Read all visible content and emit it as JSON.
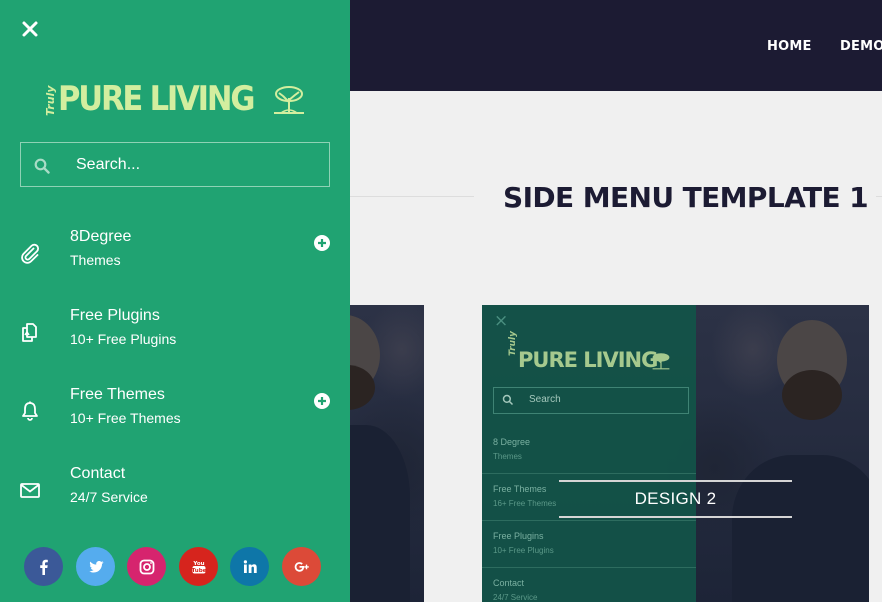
{
  "nav": {
    "home": "HOME",
    "demo": "DEMO"
  },
  "page": {
    "heading": "SIDE MENU TEMPLATE 1"
  },
  "thumbnail": {
    "label": "DESIGN 2",
    "mini_menu": {
      "close_icon": "×",
      "logo_small": "Truly",
      "logo": "PURE LIVING",
      "search_placeholder": "Search",
      "items": [
        {
          "title": "8 Degree",
          "sub": "Themes"
        },
        {
          "title": "Free Themes",
          "sub": "16+ Free Themes"
        },
        {
          "title": "Free Plugins",
          "sub": "10+ Free Plugins"
        },
        {
          "title": "Contact",
          "sub": "24/7 Service"
        }
      ]
    }
  },
  "sidemenu": {
    "logo_small": "Truly",
    "logo": "PURE LIVING",
    "search_placeholder": "Search...",
    "items": [
      {
        "title": "8Degree",
        "sub": "Themes",
        "icon": "paperclip-icon",
        "expandable": true
      },
      {
        "title": "Free Plugins",
        "sub": "10+ Free Plugins",
        "icon": "copy-icon",
        "expandable": false
      },
      {
        "title": "Free Themes",
        "sub": "10+ Free Themes",
        "icon": "bell-icon",
        "expandable": true
      },
      {
        "title": "Contact",
        "sub": "24/7 Service",
        "icon": "envelope-icon",
        "expandable": false
      }
    ],
    "social": [
      {
        "name": "facebook",
        "icon": "facebook-icon",
        "color": "#3b5998"
      },
      {
        "name": "twitter",
        "icon": "twitter-icon",
        "color": "#55acee"
      },
      {
        "name": "instagram",
        "icon": "instagram-icon",
        "color": "#d6246e"
      },
      {
        "name": "youtube",
        "icon": "youtube-icon",
        "color": "#d6241d"
      },
      {
        "name": "linkedin",
        "icon": "linkedin-icon",
        "color": "#0e76a8"
      },
      {
        "name": "google-plus",
        "icon": "google-plus-icon",
        "color": "#dc4a38"
      }
    ]
  },
  "colors": {
    "sidemenu_bg": "#20a372",
    "topbar_bg": "#1c1b33",
    "logo": "#d3ee9f"
  }
}
